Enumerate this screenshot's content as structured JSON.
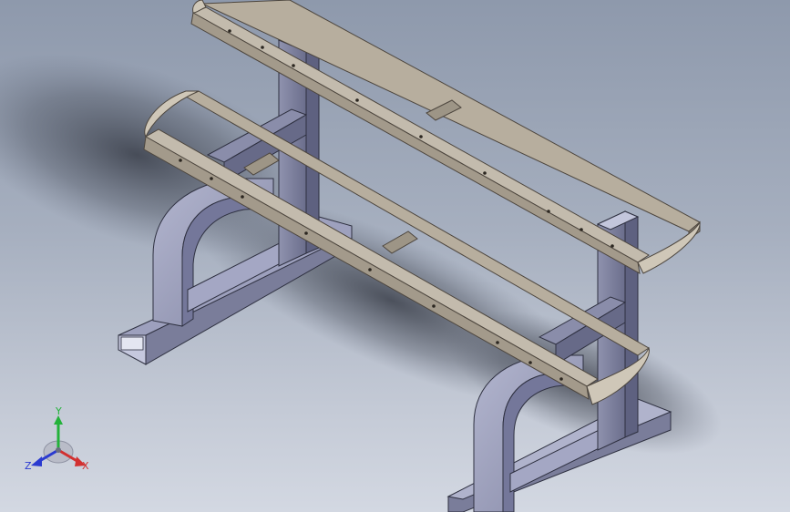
{
  "colors": {
    "background_top": "#8e99ac",
    "background_bottom": "#d3d8e2",
    "frame_face_light": "#a9acc6",
    "frame_face_dark": "#6f7290",
    "tray_face": "#b7ae9e",
    "tray_edge": "#5a5248",
    "axis_x": "#d23030",
    "axis_y": "#23b23a",
    "axis_z": "#2a3ad0"
  },
  "triad": {
    "x_label": "X",
    "y_label": "Y",
    "z_label": "Z"
  }
}
